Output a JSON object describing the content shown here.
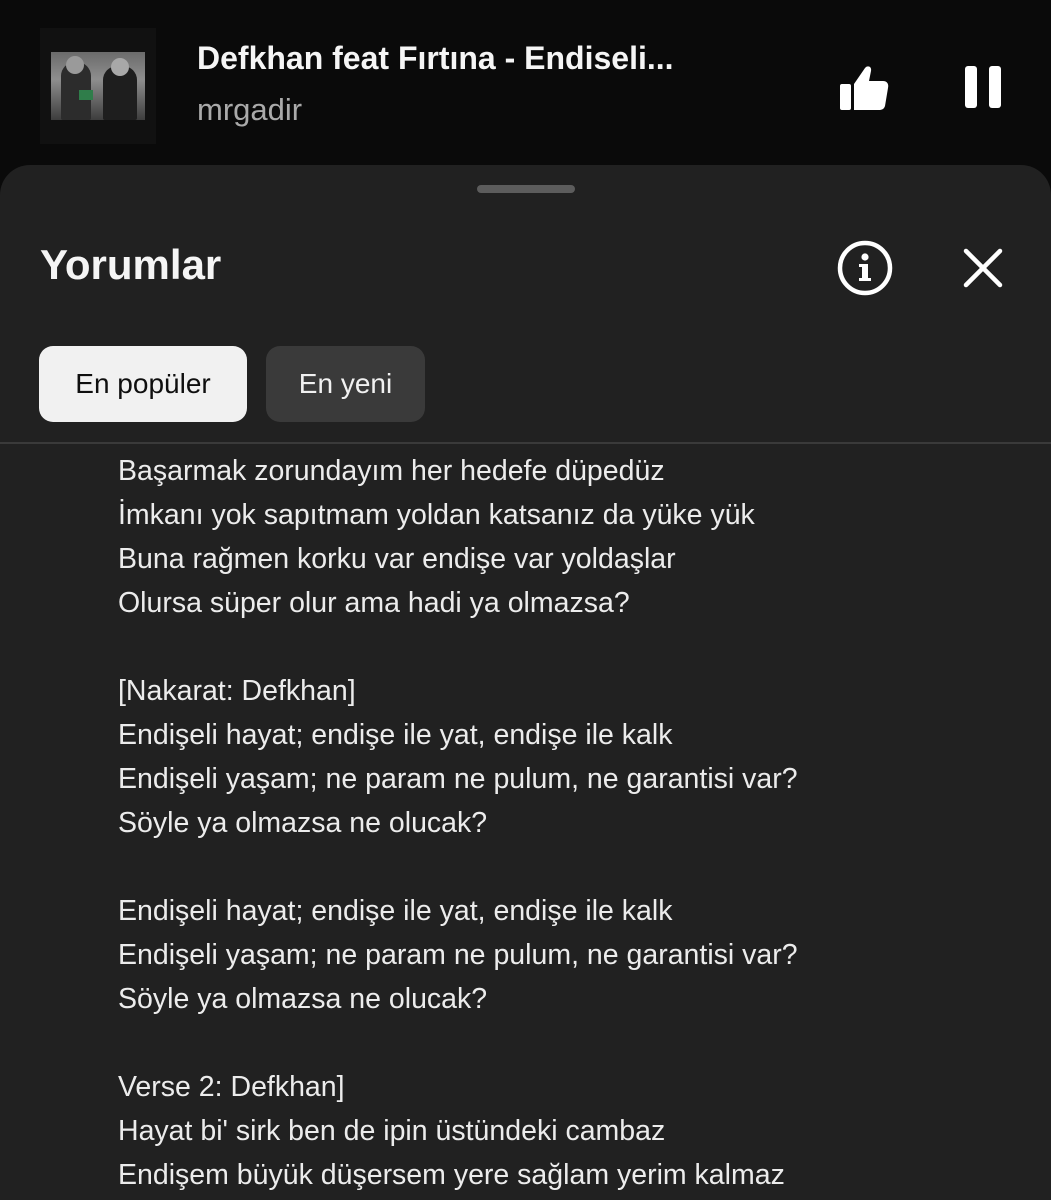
{
  "player": {
    "title": "Defkhan feat Fırtına - Endiseli...",
    "artist": "mrgadir",
    "like_icon": "thumbs-up-icon",
    "pause_icon": "pause-icon"
  },
  "sheet": {
    "title": "Yorumlar",
    "info_icon": "info-icon",
    "close_icon": "close-icon",
    "chips": {
      "popular": "En popüler",
      "newest": "En yeni"
    }
  },
  "lyrics": [
    "Başarmak zorundayım her hedefe düpedüz",
    "İmkanı yok sapıtmam yoldan katsanız da yüke yük",
    "Buna rağmen korku var endişe var yoldaşlar",
    "Olursa süper olur ama hadi ya olmazsa?",
    "",
    "[Nakarat: Defkhan]",
    "Endişeli hayat; endişe ile yat, endişe ile kalk",
    "Endişeli yaşam; ne param ne pulum, ne garantisi var?",
    "Söyle ya olmazsa ne olucak?",
    "",
    "Endişeli hayat; endişe ile yat, endişe ile kalk",
    "Endişeli yaşam; ne param ne pulum, ne garantisi var?",
    "Söyle ya olmazsa ne olucak?",
    "",
    "Verse 2: Defkhan]",
    "Hayat bi' sirk ben de ipin üstündeki cambaz",
    "Endişem büyük düşersem yere sağlam yerim kalmaz"
  ]
}
